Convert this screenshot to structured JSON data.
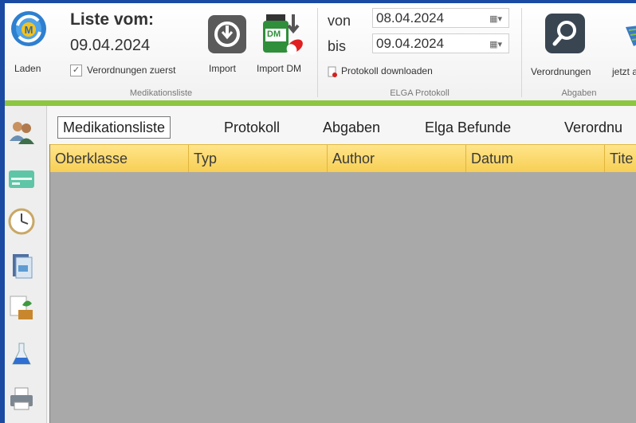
{
  "ribbon": {
    "liste": {
      "title": "Liste vom:",
      "date": "09.04.2024",
      "laden_label": "Laden",
      "checkbox_label": "Verordnungen zuerst",
      "import_label": "Import",
      "import_dm_label": "Import DM",
      "dm_badge": "DM",
      "group_label": "Medikationsliste"
    },
    "elga": {
      "von_label": "von",
      "von_value": "08.04.2024",
      "bis_label": "bis",
      "bis_value": "09.04.2024",
      "download_label": "Protokoll downloaden",
      "group_label": "ELGA Protokoll"
    },
    "abgaben": {
      "verordnungen_label": "Verordnungen",
      "jetzt_label": "jetzt a",
      "group_label": "Abgaben"
    }
  },
  "tabs": [
    {
      "label": "Medikationsliste",
      "active": true
    },
    {
      "label": "Protokoll",
      "active": false
    },
    {
      "label": "Abgaben",
      "active": false
    },
    {
      "label": "Elga Befunde",
      "active": false
    },
    {
      "label": "Verordnu",
      "active": false
    }
  ],
  "table": {
    "columns": [
      "Oberklasse",
      "Typ",
      "Author",
      "Datum",
      "Tite"
    ],
    "rows": []
  },
  "colors": {
    "frame_blue": "#1b4aa3",
    "accent_green": "#8dc63f",
    "header_yellow": "#f7cf55",
    "grid_grey": "#a9a9a9"
  },
  "icons": {
    "laden": "refresh-logo-icon",
    "import": "clock-download-icon",
    "import_dm": "medicine-bottle-icon",
    "verordnungen": "magnifier-icon",
    "side": [
      "patients-icon",
      "card-icon",
      "clock-icon",
      "document-icon",
      "plant-icon",
      "flask-icon",
      "printer-icon"
    ]
  }
}
